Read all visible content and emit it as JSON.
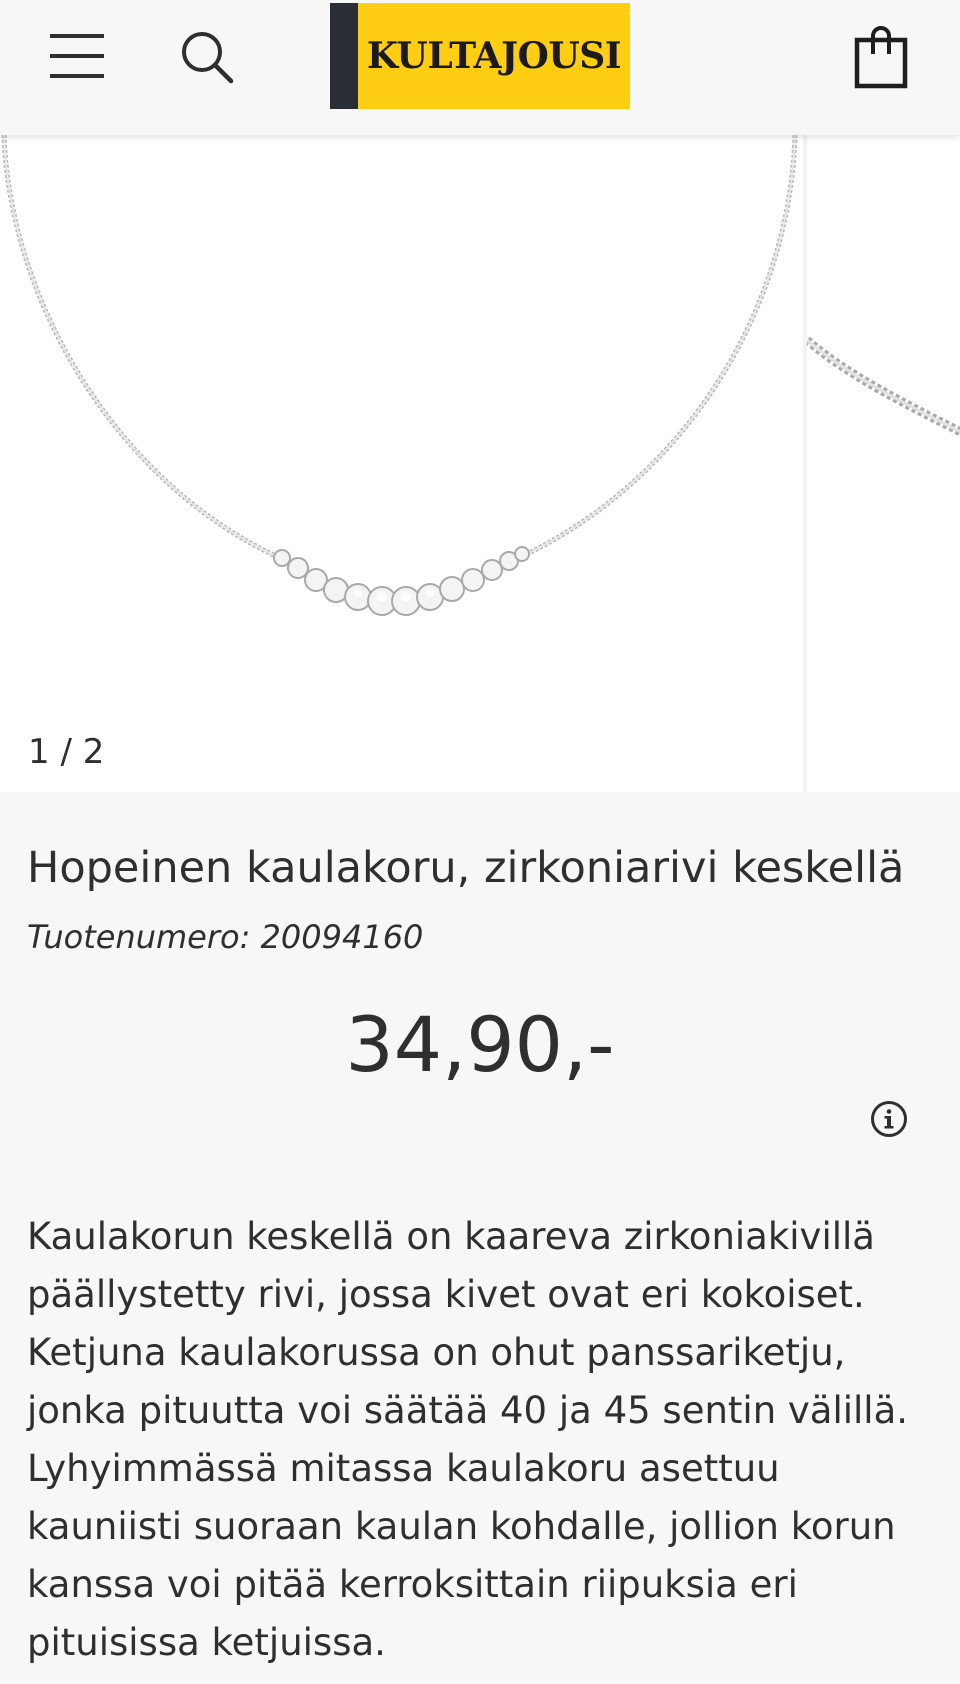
{
  "header": {
    "menu_icon": "hamburger-menu-icon",
    "search_icon": "search-icon",
    "logo_text": "KULTAJOUSI",
    "cart_icon": "shopping-bag-icon",
    "brand_yellow": "#ffcd12",
    "brand_dark": "#2a2d34"
  },
  "gallery": {
    "counter": "1 / 2"
  },
  "product": {
    "title": "Hopeinen kaulakoru, zirkoniarivi keskellä",
    "sku_label": "Tuotenumero:",
    "sku_value": "20094160",
    "price": "34,90,-",
    "info_icon": "info-icon",
    "description_lines": [
      "Kaulakorun keskellä on kaareva zirkoniakivillä",
      "päällystetty rivi, jossa kivet ovat eri kokoiset.",
      "Ketjuna kaulakorussa on ohut panssariketju,",
      "jonka pituutta voi säätää 40 ja 45 sentin välillä.",
      "Lyhyimmässä mitassa kaulakoru asettuu",
      "kauniisti suoraan kaulan kohdalle, jollion korun",
      "kanssa voi pitää kerroksittain riipuksia eri",
      "pituisissa ketjuissa."
    ]
  }
}
